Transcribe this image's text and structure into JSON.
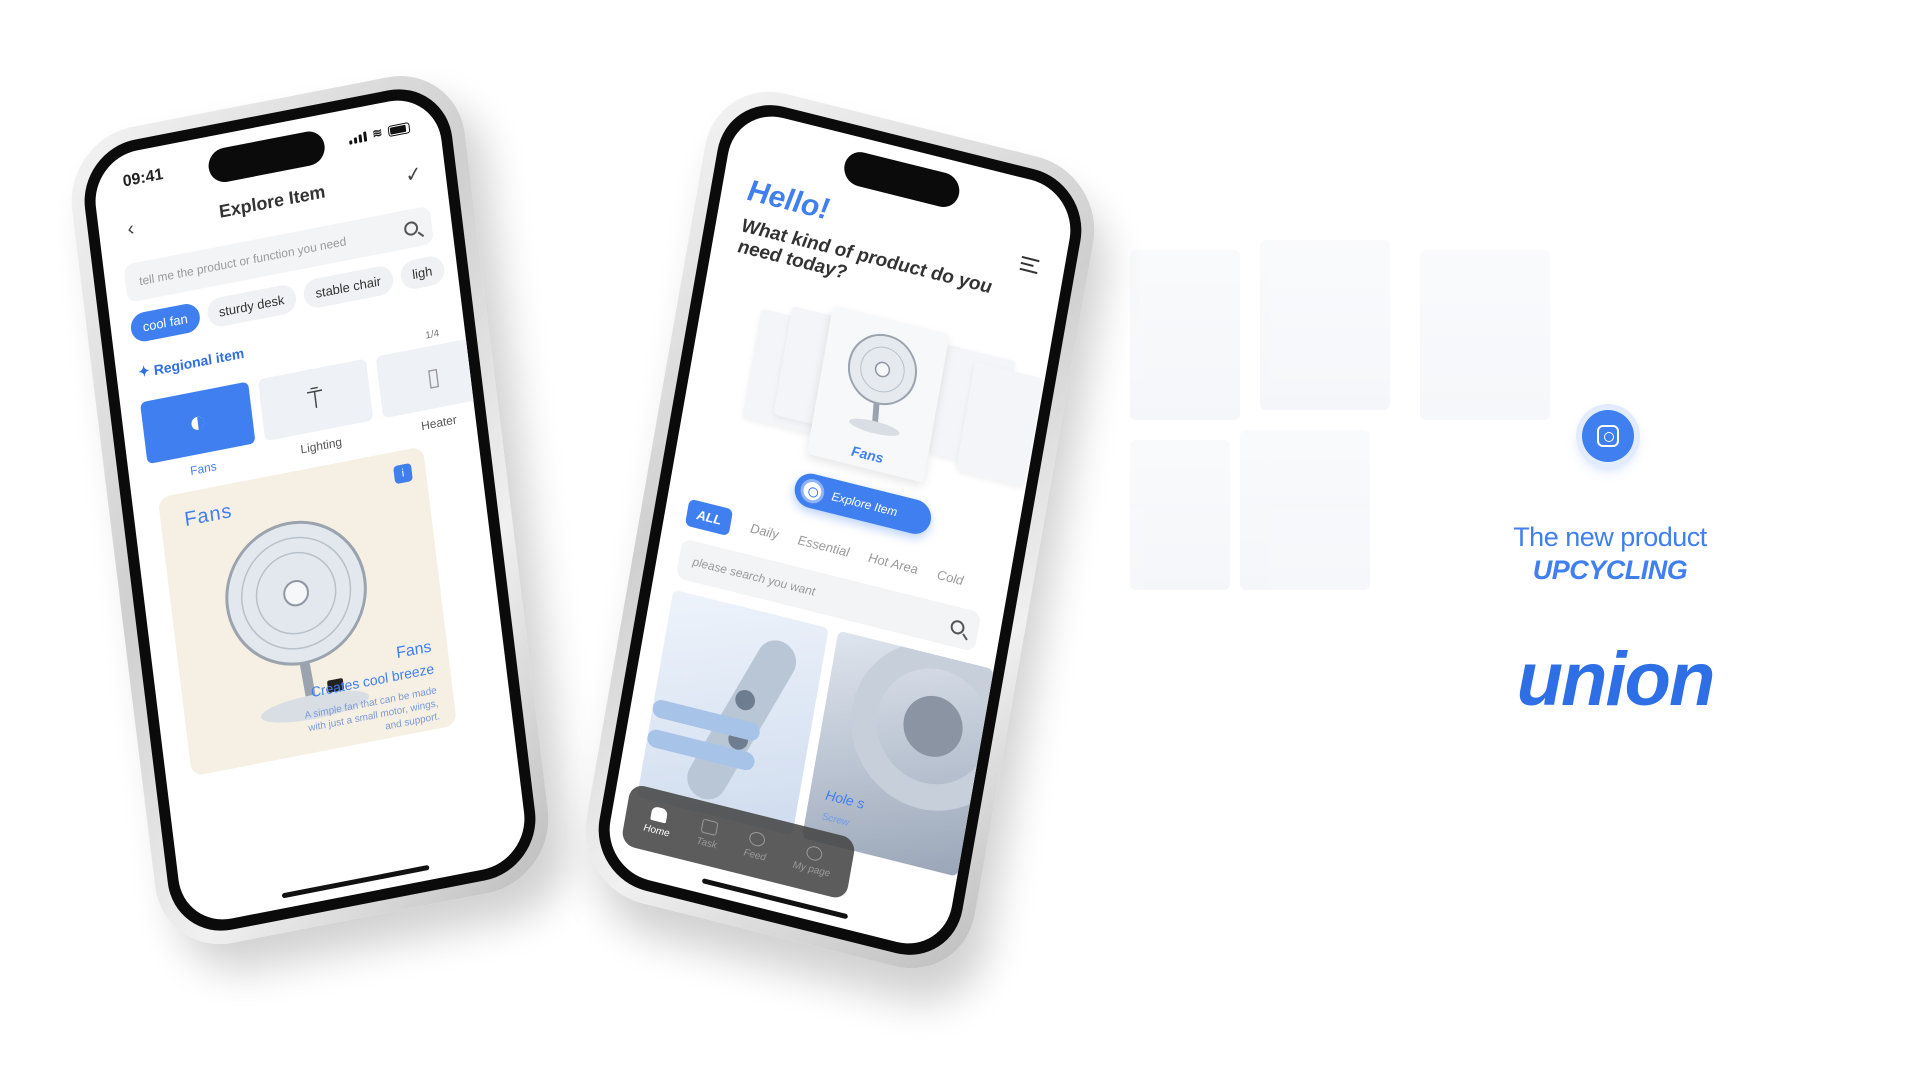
{
  "left_screen": {
    "status": {
      "time": "09:41"
    },
    "title": "Explore Item",
    "search": {
      "placeholder": "tell me the product or function you need"
    },
    "chips": [
      "cool fan",
      "sturdy desk",
      "stable chair",
      "ligh"
    ],
    "regional_label": "Regional item",
    "pager": "1/4",
    "categories": [
      "Fans",
      "Lighting",
      "Heater"
    ],
    "card": {
      "title": "Fans",
      "info": "i",
      "name": "Fans",
      "subtitle": "Creates cool breeze",
      "description": "A simple fan that can be made with just a small motor, wings, and support."
    }
  },
  "right_screen": {
    "hello": "Hello!",
    "question": "What kind of product do you need today?",
    "featured_label": "Fans",
    "explore_button": "Explore Item",
    "tabs": [
      "ALL",
      "Daily",
      "Essential",
      "Hot Area",
      "Cold"
    ],
    "search": {
      "placeholder": "please search you want"
    },
    "tile2": {
      "name": "Hole s",
      "sub": "Screw"
    },
    "nav": [
      "Home",
      "Task",
      "Feed",
      "My page"
    ]
  },
  "brand": {
    "tagline_1": "The new product",
    "tagline_2": "UPCYCLING",
    "logo": "union",
    "accent": "#3f7ff0"
  }
}
